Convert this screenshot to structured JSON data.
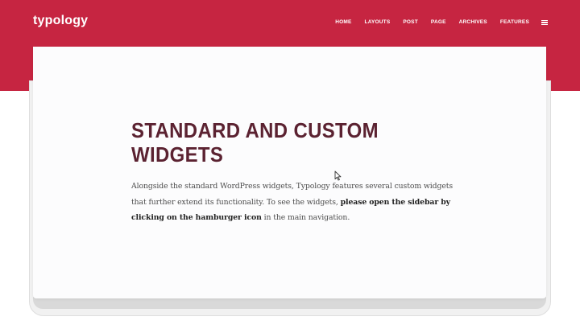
{
  "header": {
    "logo": "typology",
    "nav": {
      "items": [
        {
          "label": "HOME"
        },
        {
          "label": "LAYOUTS"
        },
        {
          "label": "POST"
        },
        {
          "label": "PAGE"
        },
        {
          "label": "ARCHIVES"
        },
        {
          "label": "FEATURES"
        }
      ],
      "menu_icon": "hamburger-icon"
    }
  },
  "content": {
    "title": "STANDARD AND CUSTOM WIDGETS",
    "body": {
      "part1": "Alongside the standard WordPress widgets, Typology features several custom widgets that further extend its functionality. To see the widgets, ",
      "emphasis": "please open the sidebar by clicking on the hamburger icon",
      "part2": " in the main navigation."
    }
  },
  "cursor_icon": "mouse-pointer-icon",
  "colors": {
    "header": "#c62541",
    "title": "#5b2231",
    "text": "#4d4d4d"
  }
}
